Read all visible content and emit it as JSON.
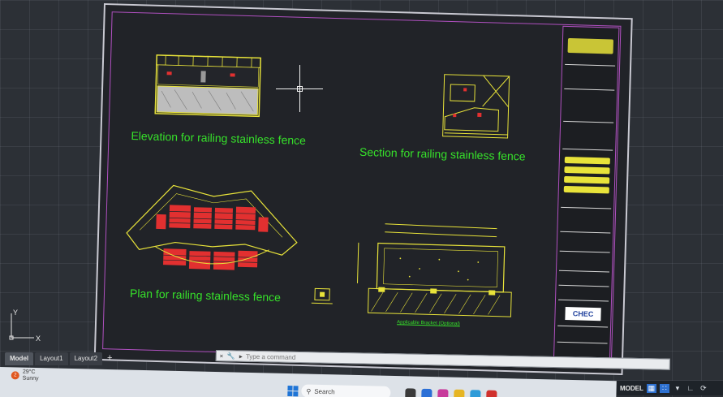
{
  "drawing": {
    "labels": {
      "elevation": "Elevation for railing stainless fence",
      "section": "Section for railing stainless fence",
      "plan": "Plan for railing stainless fence",
      "bracket": "Applicable Bracket (Optional)"
    },
    "title_block": {
      "logo_text": "CHEC"
    }
  },
  "layout_tabs": [
    {
      "label": "Model",
      "active": true
    },
    {
      "label": "Layout1",
      "active": false
    },
    {
      "label": "Layout2",
      "active": false
    },
    {
      "label": "+",
      "active": false
    }
  ],
  "command_line": {
    "close_icon": "×",
    "wrench_icon": "🔧",
    "prompt_icon": "▸",
    "placeholder": "Type a command"
  },
  "status_bar": {
    "model_label": "MODEL",
    "icons": [
      "grid-icon",
      "snap-icon",
      "dropdown-icon",
      "ortho-icon",
      "polar-icon"
    ]
  },
  "taskbar": {
    "weather_temp": "29°C",
    "weather_desc": "Sunny",
    "weather_badge": "2",
    "search_label": "Search"
  },
  "ucs": {
    "x": "X",
    "y": "Y"
  },
  "colors": {
    "cad_yellow": "#e8e33a",
    "cad_red": "#e23030",
    "cad_green": "#36e02a",
    "sheet_border": "#b050c0"
  }
}
